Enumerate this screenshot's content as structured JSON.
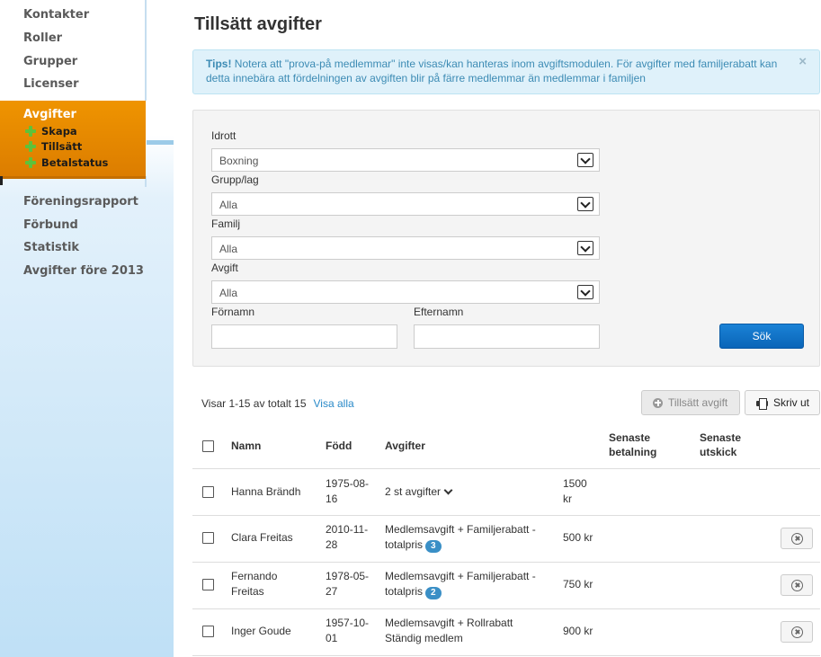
{
  "sidebar": {
    "items_top": [
      "Kontakter",
      "Roller",
      "Grupper",
      "Licenser"
    ],
    "active": {
      "label": "Avgifter",
      "sub": [
        "Skapa",
        "Tillsätt",
        "Betalstatus"
      ]
    },
    "items_bottom": [
      "Föreningsrapport",
      "Förbund",
      "Statistik",
      "Avgifter före 2013"
    ]
  },
  "page": {
    "title": "Tillsätt avgifter"
  },
  "tip": {
    "label": "Tips!",
    "text": " Notera att \"prova-på medlemmar\" inte visas/kan hanteras inom avgiftsmodulen. För avgifter med familjerabatt kan detta innebära att fördelningen av avgiften blir på färre medlemmar än medlemmar i familjen",
    "close": "×"
  },
  "filter": {
    "idrott": {
      "label": "Idrott",
      "value": "Boxning"
    },
    "grupp": {
      "label": "Grupp/lag",
      "value": "Alla"
    },
    "familj": {
      "label": "Familj",
      "value": "Alla"
    },
    "avgift": {
      "label": "Avgift",
      "value": "Alla"
    },
    "fornamn": {
      "label": "Förnamn",
      "value": ""
    },
    "efternamn": {
      "label": "Efternamn",
      "value": ""
    },
    "search_button": "Sök"
  },
  "list": {
    "summary": "Visar 1-15 av totalt 15",
    "show_all": "Visa alla",
    "assign_button": "Tillsätt avgift",
    "print_button": "Skriv ut",
    "headers": {
      "name": "Namn",
      "born": "Född",
      "fees": "Avgifter",
      "last_payment_1": "Senaste",
      "last_payment_2": "betalning",
      "last_send_1": "Senaste",
      "last_send_2": "utskick"
    },
    "rows": [
      {
        "name1": "Hanna Brändh",
        "name2": "",
        "born1": "1975-08-",
        "born2": "16",
        "fee1": "2 st avgifter",
        "fee2": "",
        "badge": "",
        "amount1": "1500",
        "amount2": "kr"
      },
      {
        "name1": "Clara Freitas",
        "name2": "",
        "born1": "2010-11-",
        "born2": "28",
        "fee1": "Medlemsavgift + Familjerabatt -",
        "fee2": "totalpris",
        "badge": "3",
        "amount1": "500 kr",
        "amount2": ""
      },
      {
        "name1": "Fernando",
        "name2": "Freitas",
        "born1": "1978-05-",
        "born2": "27",
        "fee1": "Medlemsavgift + Familjerabatt -",
        "fee2": "totalpris",
        "badge": "2",
        "amount1": "750 kr",
        "amount2": ""
      },
      {
        "name1": "Inger Goude",
        "name2": "",
        "born1": "1957-10-",
        "born2": "01",
        "fee1": "Medlemsavgift + Rollrabatt",
        "fee2": "Ständig medlem",
        "badge": "",
        "amount1": "900 kr",
        "amount2": ""
      }
    ]
  },
  "colors": {
    "accent_orange": "#e98c00",
    "primary_blue": "#0a65b8",
    "tip_bg": "#dff1fa",
    "badge_blue": "#3a8fc6"
  }
}
